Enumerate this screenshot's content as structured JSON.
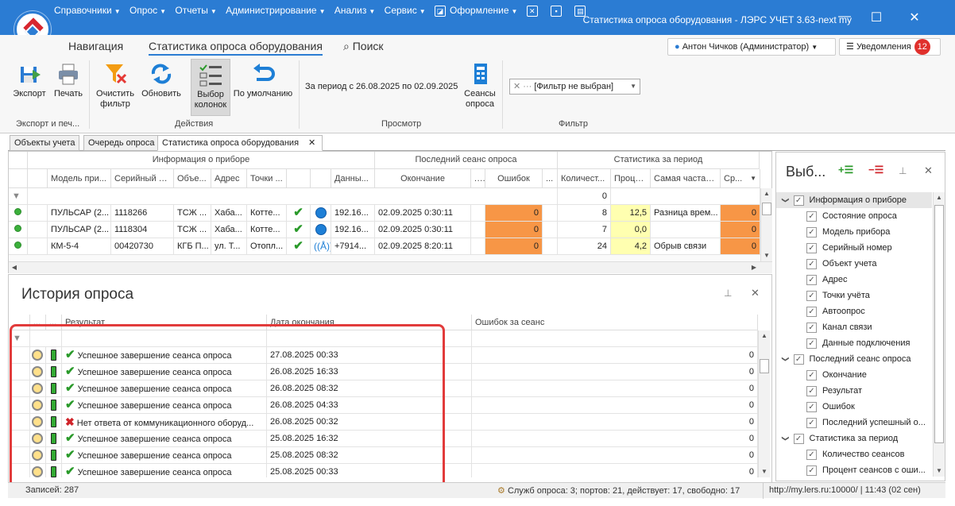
{
  "titlebar": {
    "menu": [
      "Справочники",
      "Опрос",
      "Отчеты",
      "Администрирование",
      "Анализ",
      "Сервис",
      "Оформление"
    ],
    "title": "Статистика опроса оборудования - ЛЭРС УЧЕТ 3.63-next my"
  },
  "ribbon_tabs": {
    "nav": "Навигация",
    "stats": "Статистика опроса оборудования",
    "search": "Поиск",
    "user": "Антон Чичков (Администратор)",
    "notifications": "Уведомления",
    "notif_count": "12"
  },
  "ribbon": {
    "export": "Экспорт",
    "print": "Печать",
    "clear_filter": [
      "Очистить",
      "фильтр"
    ],
    "refresh": "Обновить",
    "select_cols": [
      "Выбор",
      "колонок"
    ],
    "default": "По умолчанию",
    "period": "За период с 26.08.2025 по 02.09.2025",
    "sessions": [
      "Сеансы",
      "опроса"
    ],
    "filter_value": "[Фильтр не выбран]",
    "groups": [
      "Экспорт и печ...",
      "Действия",
      "Просмотр",
      "Фильтр"
    ]
  },
  "doc_tabs": [
    "Объекты учета",
    "Очередь опроса",
    "Статистика опроса оборудования"
  ],
  "main_grid": {
    "bands": [
      "Информация о приборе",
      "Последний сеанс опроса",
      "Статистика за период"
    ],
    "columns": [
      "Модель при...",
      "Серийный н...",
      "Объе...",
      "Адрес",
      "Точки ...",
      "",
      "",
      "Данны...",
      "Окончание",
      "...",
      "Ошибок",
      "...",
      "Количест...",
      "Проце...",
      "Самая частая...",
      "Ср..."
    ],
    "filter_count": "0",
    "rows": [
      {
        "model": "ПУЛЬСАР (2...",
        "serial": "1118266",
        "obj": "ТСЖ ...",
        "addr": "Хаба...",
        "points": "Котте...",
        "channel": "globe",
        "data": "192.16...",
        "end": "02.09.2025 0:30:11",
        "errors": "0",
        "count": "8",
        "pct": "12,5",
        "frequent": "Разница врем...",
        "avg": "0"
      },
      {
        "model": "ПУЛЬСАР (2...",
        "serial": "1118304",
        "obj": "ТСЖ ...",
        "addr": "Хаба...",
        "points": "Котте...",
        "channel": "globe",
        "data": "192.16...",
        "end": "02.09.2025 0:30:11",
        "errors": "0",
        "count": "7",
        "pct": "0,0",
        "frequent": "",
        "avg": "0"
      },
      {
        "model": "КМ-5-4",
        "serial": "00420730",
        "obj": "КГБ П...",
        "addr": "ул. Т...",
        "points": "Отопл...",
        "channel": "tower",
        "data": "+7914...",
        "end": "02.09.2025 8:20:11",
        "errors": "0",
        "count": "24",
        "pct": "4,2",
        "frequent": "Обрыв связи",
        "avg": "0"
      }
    ]
  },
  "history": {
    "title": "История опроса",
    "columns": [
      "...",
      "...",
      "Результат",
      "Дата окончания",
      "Ошибок за сеанс"
    ],
    "rows": [
      {
        "ok": true,
        "result": "Успешное завершение сеанса опроса",
        "date": "27.08.2025 00:33",
        "errors": "0"
      },
      {
        "ok": true,
        "result": "Успешное завершение сеанса опроса",
        "date": "26.08.2025 16:33",
        "errors": "0"
      },
      {
        "ok": true,
        "result": "Успешное завершение сеанса опроса",
        "date": "26.08.2025 08:32",
        "errors": "0"
      },
      {
        "ok": true,
        "result": "Успешное завершение сеанса опроса",
        "date": "26.08.2025 04:33",
        "errors": "0"
      },
      {
        "ok": false,
        "result": "Нет ответа от коммуникационного оборуд...",
        "date": "26.08.2025 00:32",
        "errors": "0"
      },
      {
        "ok": true,
        "result": "Успешное завершение сеанса опроса",
        "date": "25.08.2025 16:32",
        "errors": "0"
      },
      {
        "ok": true,
        "result": "Успешное завершение сеанса опроса",
        "date": "25.08.2025 08:32",
        "errors": "0"
      },
      {
        "ok": true,
        "result": "Успешное завершение сеанса опроса",
        "date": "25.08.2025 00:33",
        "errors": "0"
      }
    ]
  },
  "status": {
    "records": "Записей: 287",
    "services": "Служб опроса: 3; портов: 21, действует: 17, свободно: 17",
    "server": "http://my.lers.ru:10000/ | 11:43 (02 сен)"
  },
  "column_chooser": {
    "title": "Выб...",
    "tree": [
      {
        "label": "Информация о приборе",
        "level": 0
      },
      {
        "label": "Состояние опроса",
        "level": 1
      },
      {
        "label": "Модель прибора",
        "level": 1
      },
      {
        "label": "Серийный номер",
        "level": 1
      },
      {
        "label": "Объект учета",
        "level": 1
      },
      {
        "label": "Адрес",
        "level": 1
      },
      {
        "label": "Точки учёта",
        "level": 1
      },
      {
        "label": "Автоопрос",
        "level": 1
      },
      {
        "label": "Канал связи",
        "level": 1
      },
      {
        "label": "Данные подключения",
        "level": 1
      },
      {
        "label": "Последний сеанс опроса",
        "level": 0
      },
      {
        "label": "Окончание",
        "level": 1
      },
      {
        "label": "Результат",
        "level": 1
      },
      {
        "label": "Ошибок",
        "level": 1
      },
      {
        "label": "Последний успешный о...",
        "level": 1
      },
      {
        "label": "Статистика за период",
        "level": 0
      },
      {
        "label": "Количество сеансов",
        "level": 1
      },
      {
        "label": "Процент сеансов с оши...",
        "level": 1
      }
    ]
  },
  "colors": {
    "accent": "#2b7cd3",
    "error_cell": "#f79646",
    "highlight": "#ffffb0",
    "annotation": "#e23b3b"
  }
}
